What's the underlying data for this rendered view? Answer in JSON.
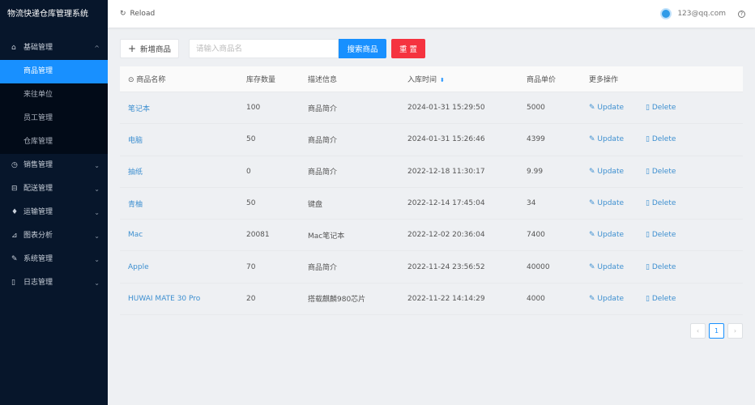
{
  "app": {
    "title": "物流快递仓库管理系统"
  },
  "header": {
    "reload": "Reload",
    "user": "123@qq.com"
  },
  "sidebar": {
    "groups": [
      {
        "label": "基础管理",
        "icon": "home-icon",
        "expanded": true,
        "items": [
          {
            "label": "商品管理",
            "active": true
          },
          {
            "label": "来往单位"
          },
          {
            "label": "员工管理"
          },
          {
            "label": "仓库管理"
          }
        ]
      },
      {
        "label": "销售管理",
        "icon": "clock-icon"
      },
      {
        "label": "配送管理",
        "icon": "car-icon"
      },
      {
        "label": "运输管理",
        "icon": "bell-icon"
      },
      {
        "label": "图表分析",
        "icon": "chart-icon"
      },
      {
        "label": "系统管理",
        "icon": "wrench-icon"
      },
      {
        "label": "日志管理",
        "icon": "file-icon"
      }
    ]
  },
  "toolbar": {
    "add": "新增商品",
    "placeholder": "请输入商品名",
    "search": "搜索商品",
    "reset": "重 置"
  },
  "table": {
    "headers": [
      "商品名称",
      "库存数量",
      "描述信息",
      "入库时间",
      "商品单价",
      "更多操作"
    ],
    "update": "Update",
    "delete": "Delete",
    "rows": [
      [
        "笔记本",
        "100",
        "商品简介",
        "2024-01-31 15:29:50",
        "5000"
      ],
      [
        "电脑",
        "50",
        "商品简介",
        "2024-01-31 15:26:46",
        "4399"
      ],
      [
        "抽纸",
        "0",
        "商品简介",
        "2022-12-18 11:30:17",
        "9.99"
      ],
      [
        "青柚",
        "50",
        "键盘",
        "2022-12-14 17:45:04",
        "34"
      ],
      [
        "Mac",
        "20081",
        "Mac笔记本",
        "2022-12-02 20:36:04",
        "7400"
      ],
      [
        "Apple",
        "70",
        "商品简介",
        "2022-11-24 23:56:52",
        "40000"
      ],
      [
        "HUWAI MATE 30 Pro",
        "20",
        "搭载麒麟980芯片",
        "2022-11-22 14:14:29",
        "4000"
      ]
    ]
  },
  "pagination": {
    "current": "1"
  },
  "colors": {
    "primary": "#1890ff",
    "danger": "#f5333f",
    "sidebar": "#07162b"
  }
}
